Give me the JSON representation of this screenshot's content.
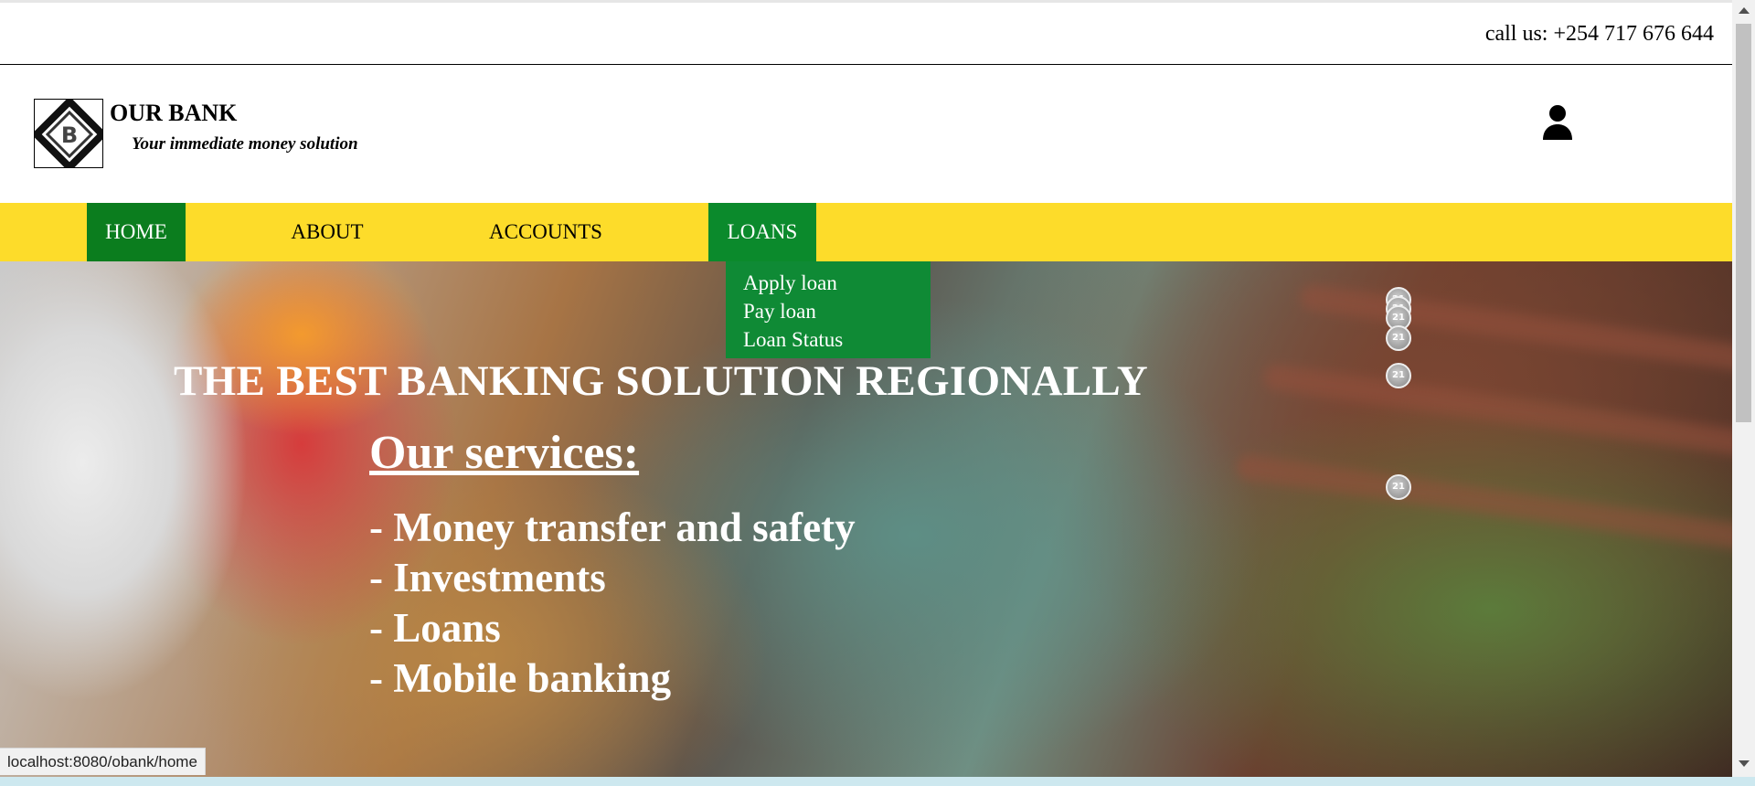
{
  "topbar": {
    "call": "call us: +254 717 676 644"
  },
  "header": {
    "brand": "OUR BANK",
    "tagline": "Your immediate money solution",
    "logo_letter": "B",
    "user_icon": "user-icon"
  },
  "nav": {
    "items": [
      {
        "label": "HOME",
        "active": true
      },
      {
        "label": "ABOUT",
        "active": false
      },
      {
        "label": "ACCOUNTS",
        "active": false
      },
      {
        "label": "LOANS",
        "active": false
      }
    ],
    "loans_dropdown": [
      "Apply loan",
      "Pay loan",
      "Loan Status"
    ]
  },
  "hero": {
    "headline": "THE BEST BANKING SOLUTION REGIONALLY",
    "services_title": "Our services:",
    "services": [
      "- Money transfer and safety",
      "- Investments",
      "- Loans",
      "- Mobile banking"
    ],
    "badge_text": "21"
  },
  "status_bar": {
    "url": "localhost:8080/obank/home"
  },
  "colors": {
    "nav_background": "#fddc2a",
    "nav_active": "#0b7d1e",
    "dropdown": "#0f8a35",
    "hero_text": "#ffffff"
  }
}
